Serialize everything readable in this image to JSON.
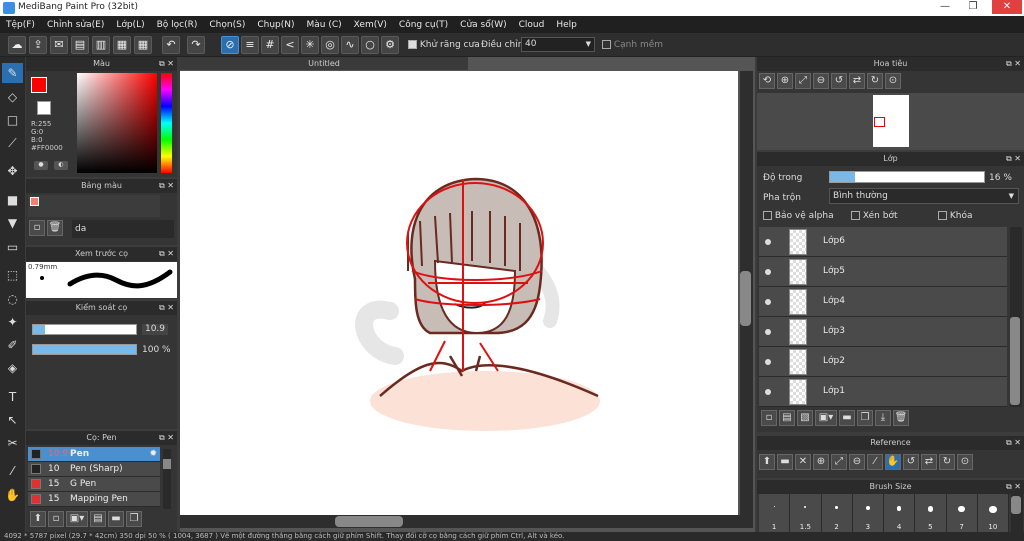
{
  "window": {
    "title": "MediBang Paint Pro (32bit)"
  },
  "menu": [
    "Tệp(F)",
    "Chỉnh sửa(E)",
    "Lớp(L)",
    "Bộ lọc(R)",
    "Chọn(S)",
    "Chụp(N)",
    "Màu (C)",
    "Xem(V)",
    "Công cụ(T)",
    "Cửa sổ(W)",
    "Cloud",
    "Help"
  ],
  "toolbar": {
    "antialias_label": "Khử răng cưa",
    "adjust_label": "Điều chỉnh",
    "adjust_value": "40",
    "smooth_label": "Cạnh mềm"
  },
  "color_panel": {
    "title": "Màu",
    "r": "R:255",
    "g": "G:0",
    "b": "B:0",
    "hex": "#FF0000",
    "current_color": "#ff0000"
  },
  "palette_panel": {
    "title": "Bảng màu",
    "name": "da"
  },
  "brush_preview": {
    "title": "Xem trước cọ",
    "size": "0.79mm"
  },
  "brush_control": {
    "title": "Kiểm soát cọ",
    "size_value": "10.9",
    "opacity_value": "100 %",
    "size_fraction": 0.12,
    "opacity_fraction": 1.0
  },
  "brush_panel": {
    "title": "Cọ: Pen",
    "items": [
      {
        "size": "10.9",
        "name": "Pen",
        "color": "#222222"
      },
      {
        "size": "10",
        "name": "Pen (Sharp)",
        "color": "#222222"
      },
      {
        "size": "15",
        "name": "G Pen",
        "color": "#e03030"
      },
      {
        "size": "15",
        "name": "Mapping Pen",
        "color": "#e03030"
      }
    ]
  },
  "canvas": {
    "tab_title": "Untitled"
  },
  "navigator": {
    "title": "Hoa tiêu"
  },
  "layer_panel": {
    "title": "Lớp",
    "opacity_label": "Độ trong",
    "opacity_value": "16 %",
    "opacity_fraction": 0.16,
    "blend_label": "Pha trộn",
    "blend_value": "Bình thường",
    "protect_alpha": "Bảo vệ alpha",
    "clipping": "Xén bớt",
    "lock": "Khóa",
    "layers": [
      "Lớp6",
      "Lớp5",
      "Lớp4",
      "Lớp3",
      "Lớp2",
      "Lớp1"
    ]
  },
  "reference_panel": {
    "title": "Reference"
  },
  "brush_size_panel": {
    "title": "Brush Size",
    "sizes": [
      "1",
      "1.5",
      "2",
      "3",
      "4",
      "5",
      "7",
      "10"
    ]
  },
  "status": "4092 * 5787 pixel  (29.7 * 42cm)  350 dpi  50 %  ( 1004, 3687 )  Vẽ một đường thẳng bằng cách giữ phím Shift. Thay đổi cỡ cọ bằng cách giữ phím Ctrl, Alt và kéo."
}
